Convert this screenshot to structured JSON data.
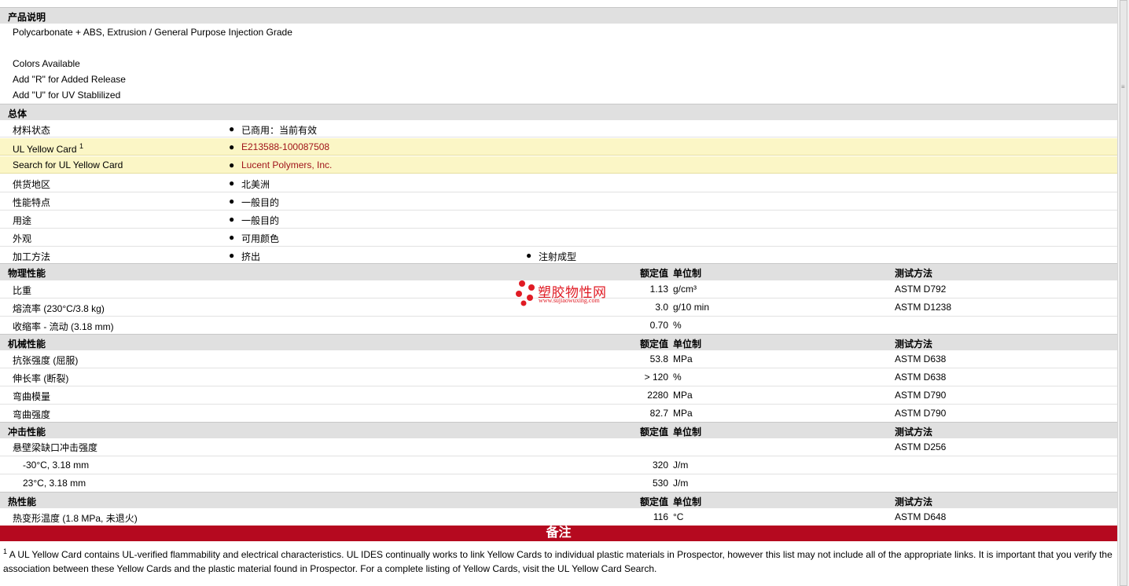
{
  "description": {
    "header": "产品说明",
    "lines": [
      "Polycarbonate + ABS, Extrusion / General Purpose Injection Grade",
      "",
      "Colors Available",
      "Add \"R\" for Added Release",
      "Add \"U\" for UV Stablilized"
    ]
  },
  "general": {
    "header": "总体",
    "material_status_label": "材料状态",
    "material_status_value": "已商用：当前有效",
    "ul_card_label": "UL Yellow Card",
    "ul_card_sup": "1",
    "ul_card_value": "E213588-100087508",
    "ul_search_label": "Search for UL Yellow Card",
    "ul_search_value": "Lucent Polymers, Inc.",
    "availability_label": "供货地区",
    "availability_value": "北美洲",
    "features_label": "性能特点",
    "features_value": "一般目的",
    "uses_label": "用途",
    "uses_value": "一般目的",
    "appearance_label": "外观",
    "appearance_value": "可用颜色",
    "processing_label": "加工方法",
    "processing_value_1": "挤出",
    "processing_value_2": "注射成型"
  },
  "columns": {
    "value": "额定值",
    "unit": "单位制",
    "method": "测试方法"
  },
  "physical": {
    "header": "物理性能",
    "rows": [
      {
        "name": "比重",
        "value": "1.13",
        "unit": "g/cm³",
        "method": "ASTM D792"
      },
      {
        "name": "熔流率  (230°C/3.8 kg)",
        "value": "3.0",
        "unit": "g/10 min",
        "method": "ASTM D1238"
      },
      {
        "name": "收缩率  - 流动  (3.18 mm)",
        "value": "0.70",
        "unit": "%",
        "method": ""
      }
    ]
  },
  "mechanical": {
    "header": "机械性能",
    "rows": [
      {
        "name": "抗张强度  (屈服)",
        "value": "53.8",
        "unit": "MPa",
        "method": "ASTM D638"
      },
      {
        "name": "伸长率  (断裂)",
        "value": "> 120",
        "unit": "%",
        "method": "ASTM D638"
      },
      {
        "name": "弯曲模量",
        "value": "2280",
        "unit": "MPa",
        "method": "ASTM D790"
      },
      {
        "name": "弯曲强度",
        "value": "82.7",
        "unit": "MPa",
        "method": "ASTM D790"
      }
    ]
  },
  "impact": {
    "header": "冲击性能",
    "parent": {
      "name": "悬壁梁缺口冲击强度",
      "method": "ASTM D256"
    },
    "rows": [
      {
        "name": "-30°C, 3.18 mm",
        "value": "320",
        "unit": "J/m"
      },
      {
        "name": "23°C, 3.18 mm",
        "value": "530",
        "unit": "J/m"
      }
    ]
  },
  "thermal": {
    "header": "热性能",
    "rows": [
      {
        "name": "热变形温度  (1.8 MPa, 未退火)",
        "value": "116",
        "unit": "°C",
        "method": "ASTM D648"
      }
    ]
  },
  "notes": {
    "header": "备注",
    "footnote_sup": "1",
    "footnote_text": "A UL Yellow Card contains UL-verified flammability and electrical characteristics. UL IDES continually works to link Yellow Cards to individual plastic materials in Prospector, however this list may not include all of the appropriate links. It is important that you verify the association between these Yellow Cards and the plastic material found in Prospector. For a complete listing of Yellow Cards, visit the UL Yellow Card Search."
  },
  "watermark": {
    "title": "塑胶物性网",
    "url": "www.sujiaowuxing.com"
  },
  "colors": {
    "section_header_bg": "#e0e0e0",
    "notes_bar": "#b5091f",
    "link_text": "#a0141b",
    "highlight_row": "#fbf6c6"
  }
}
